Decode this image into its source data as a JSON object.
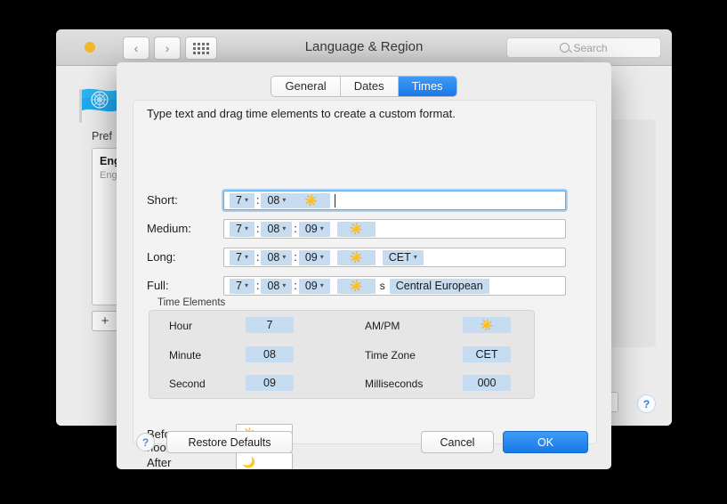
{
  "window": {
    "title": "Language & Region",
    "search_placeholder": "Search",
    "search_icon": "search-icon",
    "traffic_lights": [
      "close",
      "minimize",
      "zoom"
    ],
    "nav_back_icon": "chevron-left-icon",
    "nav_forward_icon": "chevron-right-icon",
    "grid_icon": "grid-view-icon",
    "flag_icon": "united-nations-flag-icon",
    "preferred_label": "Pref",
    "language_item_main": "Eng",
    "language_item_sub": "Eng",
    "add_button_label": "+",
    "help_label": "?"
  },
  "sheet": {
    "tabs": [
      {
        "label": "General",
        "active": false
      },
      {
        "label": "Dates",
        "active": false
      },
      {
        "label": "Times",
        "active": true
      }
    ],
    "hint": "Type text and drag time elements to create a custom format.",
    "formats": [
      {
        "label": "Short:",
        "focused": true,
        "parts": [
          {
            "kind": "token",
            "text": "7",
            "caret": true
          },
          {
            "kind": "sep",
            "text": ":"
          },
          {
            "kind": "token",
            "text": "08",
            "caret": true
          },
          {
            "kind": "sun"
          },
          {
            "kind": "cursor"
          }
        ]
      },
      {
        "label": "Medium:",
        "focused": false,
        "parts": [
          {
            "kind": "token",
            "text": "7",
            "caret": true
          },
          {
            "kind": "sep",
            "text": ":"
          },
          {
            "kind": "token",
            "text": "08",
            "caret": true
          },
          {
            "kind": "sep",
            "text": ":"
          },
          {
            "kind": "token",
            "text": "09",
            "caret": true
          },
          {
            "kind": "sun"
          }
        ]
      },
      {
        "label": "Long:",
        "focused": false,
        "parts": [
          {
            "kind": "token",
            "text": "7",
            "caret": true
          },
          {
            "kind": "sep",
            "text": ":"
          },
          {
            "kind": "token",
            "text": "08",
            "caret": true
          },
          {
            "kind": "sep",
            "text": ":"
          },
          {
            "kind": "token",
            "text": "09",
            "caret": true
          },
          {
            "kind": "sun"
          },
          {
            "kind": "token",
            "text": "CET",
            "caret": true
          }
        ]
      },
      {
        "label": "Full:",
        "focused": false,
        "parts": [
          {
            "kind": "token",
            "text": "7",
            "caret": true
          },
          {
            "kind": "sep",
            "text": ":"
          },
          {
            "kind": "token",
            "text": "08",
            "caret": true
          },
          {
            "kind": "sep",
            "text": ":"
          },
          {
            "kind": "token",
            "text": "09",
            "caret": true
          },
          {
            "kind": "sun"
          },
          {
            "kind": "plain",
            "text": "s"
          },
          {
            "kind": "token",
            "text": "Central European",
            "caret": false
          }
        ]
      }
    ],
    "time_elements": {
      "title": "Time Elements",
      "left": [
        {
          "label": "Hour",
          "value": "7"
        },
        {
          "label": "Minute",
          "value": "08"
        },
        {
          "label": "Second",
          "value": "09"
        }
      ],
      "right": [
        {
          "label": "AM/PM",
          "value": "☀️",
          "is_icon": true
        },
        {
          "label": "Time Zone",
          "value": "CET",
          "is_icon": false
        },
        {
          "label": "Milliseconds",
          "value": "000",
          "is_icon": false
        }
      ]
    },
    "noon": [
      {
        "label": "Before noon:",
        "glyph": "☀️",
        "icon_name": "sun-icon"
      },
      {
        "label": "After noon:",
        "glyph": "🌙",
        "icon_name": "crescent-moon-icon"
      }
    ],
    "footer": {
      "help_label": "?",
      "restore_label": "Restore Defaults",
      "cancel_label": "Cancel",
      "ok_label": "OK"
    }
  },
  "colors": {
    "accent": "#1878e8",
    "token_bg": "#c6dcf0",
    "sheet_bg": "#ededed"
  }
}
